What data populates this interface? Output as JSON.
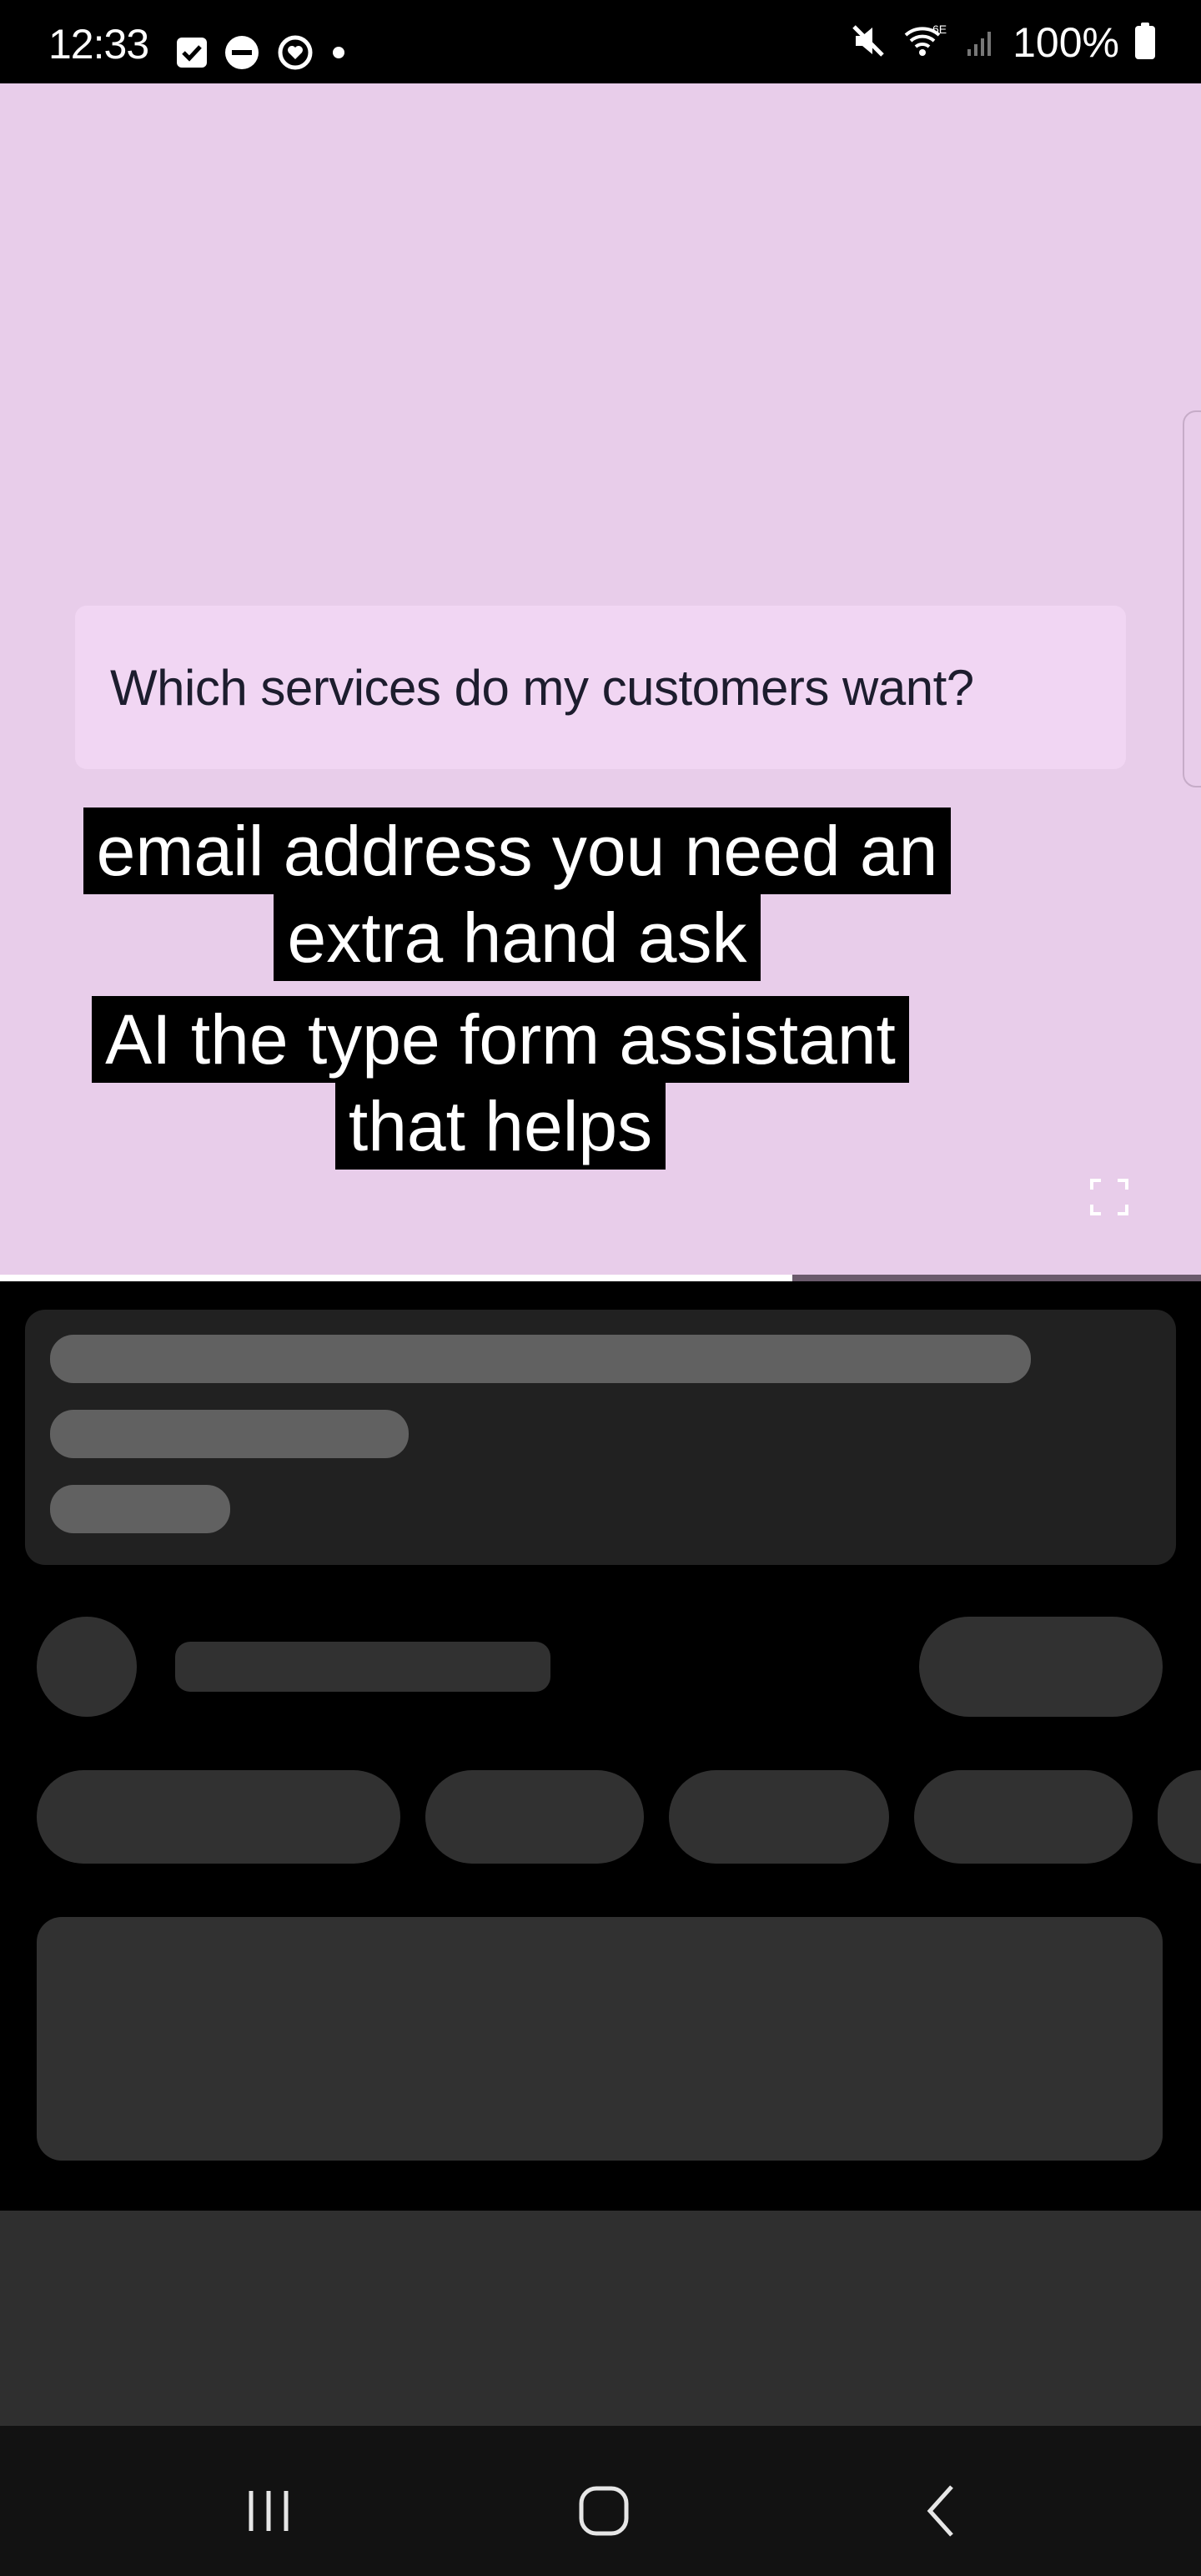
{
  "status_bar": {
    "time": "12:33",
    "battery_text": "100%",
    "left_icons": [
      "checkbox-notification-icon",
      "do-not-disturb-icon",
      "sync-heart-icon",
      "notification-dot-icon"
    ],
    "right_icons": [
      "mute-icon",
      "wifi-6e-icon",
      "signal-icon",
      "battery-icon"
    ]
  },
  "video": {
    "background_color": "#e8cdea",
    "question": "Which services do my customers want?",
    "captions": [
      [
        "email address you need an",
        "extra hand ask"
      ],
      [
        "AI the type form assistant",
        "that helps"
      ]
    ],
    "progress": 0.66
  },
  "skeleton": {
    "placeholder_color": "#616161",
    "dark_placeholder_color": "#313131"
  },
  "nav_bar": {
    "buttons": [
      "recent-apps-icon",
      "home-icon",
      "back-icon"
    ]
  }
}
